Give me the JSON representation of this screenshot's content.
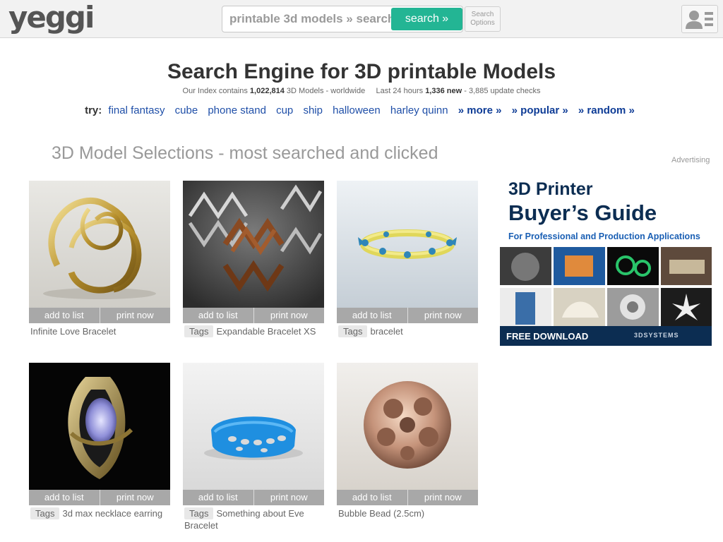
{
  "header": {
    "logo": "yeggi",
    "search_placeholder": "printable 3d models » search m",
    "search_button": "search »",
    "options_line1": "Search",
    "options_line2": "Options"
  },
  "hero": {
    "title": "Search Engine for 3D printable Models",
    "index_prefix": "Our Index contains",
    "index_count": "1,022,814",
    "index_suffix": "3D Models - worldwide",
    "last_prefix": "Last 24 hours",
    "last_new": "1,336 new",
    "last_suffix": "- 3,885 update checks",
    "try_label": "try:",
    "try_links": [
      "final fantasy",
      "cube",
      "phone stand",
      "cup",
      "ship",
      "halloween",
      "harley quinn"
    ],
    "more": "» more »",
    "popular": "» popular »",
    "random": "» random »"
  },
  "selections": {
    "heading": "3D Model Selections - most searched and clicked",
    "add_label": "add to list",
    "print_label": "print now",
    "tags_label": "Tags",
    "items": [
      {
        "name": "Infinite Love Bracelet",
        "tagged": false
      },
      {
        "name": "Expandable Bracelet XS",
        "tagged": true
      },
      {
        "name": "bracelet",
        "tagged": true
      },
      {
        "name": "3d max necklace earring",
        "tagged": true
      },
      {
        "name": "Something about Eve Bracelet",
        "tagged": true
      },
      {
        "name": "Bubble Bead (2.5cm)",
        "tagged": false
      }
    ]
  },
  "ad": {
    "advertising_label": "Advertising",
    "line1": "3D Printer",
    "line2": "Buyer’s Guide",
    "subline": "For Professional and Production Applications",
    "cta": "FREE DOWNLOAD",
    "brand": "3DSYSTEMS",
    "close_glyphs": "▷✕"
  },
  "colors": {
    "search_button": "#23b594",
    "link": "#1f4fa8",
    "action_bar": "#a8a8a8",
    "ad_navy": "#0c2d52"
  }
}
